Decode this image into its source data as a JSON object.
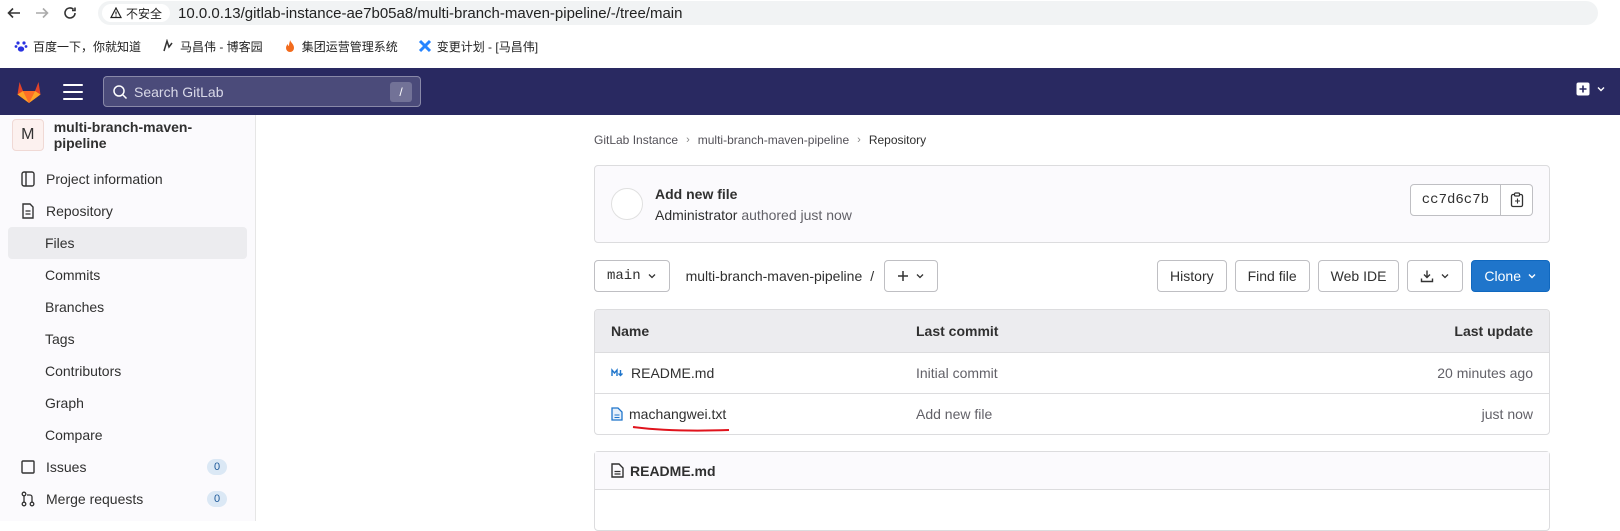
{
  "browser": {
    "security_label": "不安全",
    "url": "10.0.0.13/gitlab-instance-ae7b05a8/multi-branch-maven-pipeline/-/tree/main",
    "bookmarks": [
      {
        "label": "百度一下，你就知道",
        "icon": "baidu-paw-icon"
      },
      {
        "label": "马昌伟 - 博客园",
        "icon": "cnblogs-icon"
      },
      {
        "label": "集团运营管理系统",
        "icon": "flame-icon"
      },
      {
        "label": "变更计划 - [马昌伟]",
        "icon": "jira-icon"
      }
    ]
  },
  "header": {
    "search_placeholder": "Search GitLab",
    "search_shortcut": "/",
    "brand_color": "#292961"
  },
  "sidebar": {
    "project_avatar_letter": "M",
    "project_name": "multi-branch-maven-pipeline",
    "items": [
      {
        "label": "Project information",
        "icon": "project-info-icon"
      },
      {
        "label": "Repository",
        "icon": "repository-icon"
      },
      {
        "label": "Files",
        "active": true
      },
      {
        "label": "Commits"
      },
      {
        "label": "Branches"
      },
      {
        "label": "Tags"
      },
      {
        "label": "Contributors"
      },
      {
        "label": "Graph"
      },
      {
        "label": "Compare"
      },
      {
        "label": "Issues",
        "icon": "issues-icon",
        "badge": "0"
      },
      {
        "label": "Merge requests",
        "icon": "merge-request-icon",
        "badge": "0"
      }
    ]
  },
  "breadcrumb": [
    "GitLab Instance",
    "multi-branch-maven-pipeline",
    "Repository"
  ],
  "last_commit": {
    "title": "Add new file",
    "author": "Administrator",
    "meta_suffix": "authored just now",
    "sha": "cc7d6c7b"
  },
  "toolbar": {
    "branch": "main",
    "path": "multi-branch-maven-pipeline",
    "path_sep": "/",
    "buttons": {
      "history": "History",
      "find_file": "Find file",
      "web_ide": "Web IDE",
      "clone": "Clone"
    }
  },
  "files_table": {
    "headers": {
      "name": "Name",
      "last_commit": "Last commit",
      "last_update": "Last update"
    },
    "rows": [
      {
        "name": "README.md",
        "icon": "markdown-icon",
        "commit": "Initial commit",
        "updated": "20 minutes ago"
      },
      {
        "name": "machangwei.txt",
        "icon": "file-icon",
        "commit": "Add new file",
        "updated": "just now"
      }
    ]
  },
  "readme": {
    "title": "README.md"
  },
  "colors": {
    "primary": "#1f75cb",
    "annotation_red": "#e0131c"
  }
}
